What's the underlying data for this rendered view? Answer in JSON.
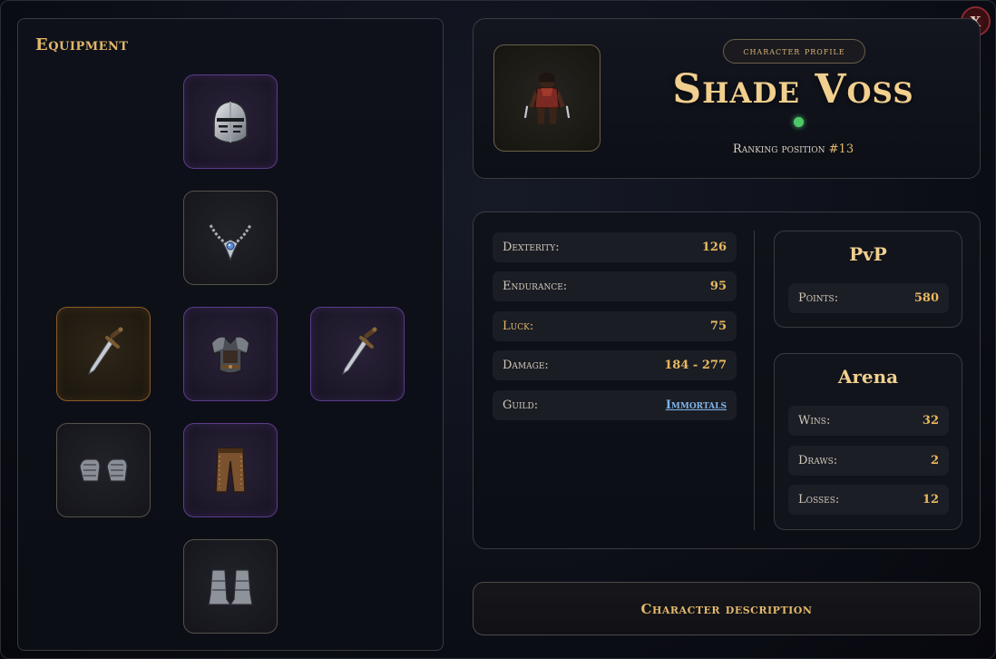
{
  "close_button": {
    "label": "X"
  },
  "equipment": {
    "title": "Equipment",
    "slots": [
      {
        "id": "helmet",
        "icon": "knight-helmet-icon",
        "rarity": "epic"
      },
      {
        "id": "amulet",
        "icon": "amulet-icon",
        "rarity": "common"
      },
      {
        "id": "main_hand",
        "icon": "dagger-icon",
        "rarity": "legendary"
      },
      {
        "id": "armor",
        "icon": "chest-armor-icon",
        "rarity": "epic"
      },
      {
        "id": "off_hand",
        "icon": "dagger-icon",
        "rarity": "epic"
      },
      {
        "id": "gloves",
        "icon": "gauntlets-icon",
        "rarity": "common"
      },
      {
        "id": "pants",
        "icon": "leather-leggings-icon",
        "rarity": "epic"
      },
      {
        "id": "boots",
        "icon": "plate-boots-icon",
        "rarity": "common"
      }
    ]
  },
  "profile": {
    "badge": "character profile",
    "name": "Shade Voss",
    "status": "online",
    "status_color": "#4ec96a",
    "ranking_label": "Ranking position",
    "ranking_value": "#13",
    "avatar_icon": "rogue-character-icon"
  },
  "stats": [
    {
      "label": "Dexterity:",
      "value": "126"
    },
    {
      "label": "Endurance:",
      "value": "95"
    },
    {
      "label": "Luck:",
      "value": "75"
    },
    {
      "label": "Damage:",
      "value": "184 - 277"
    },
    {
      "label": "Guild:",
      "value": "Immortals"
    }
  ],
  "pvp": {
    "title": "PvP",
    "points_label": "Points:",
    "points_value": "580"
  },
  "arena": {
    "title": "Arena",
    "wins_label": "Wins:",
    "wins_value": "32",
    "draws_label": "Draws:",
    "draws_value": "2",
    "losses_label": "Losses:",
    "losses_value": "12"
  },
  "description_button": {
    "label": "Character description"
  },
  "colors": {
    "accent_gold": "#e2b86a",
    "value_gold": "#e9b95e",
    "link_blue": "#7fb4e8",
    "epic_border": "#5c3c8c",
    "legendary_border": "#8a5a28"
  }
}
